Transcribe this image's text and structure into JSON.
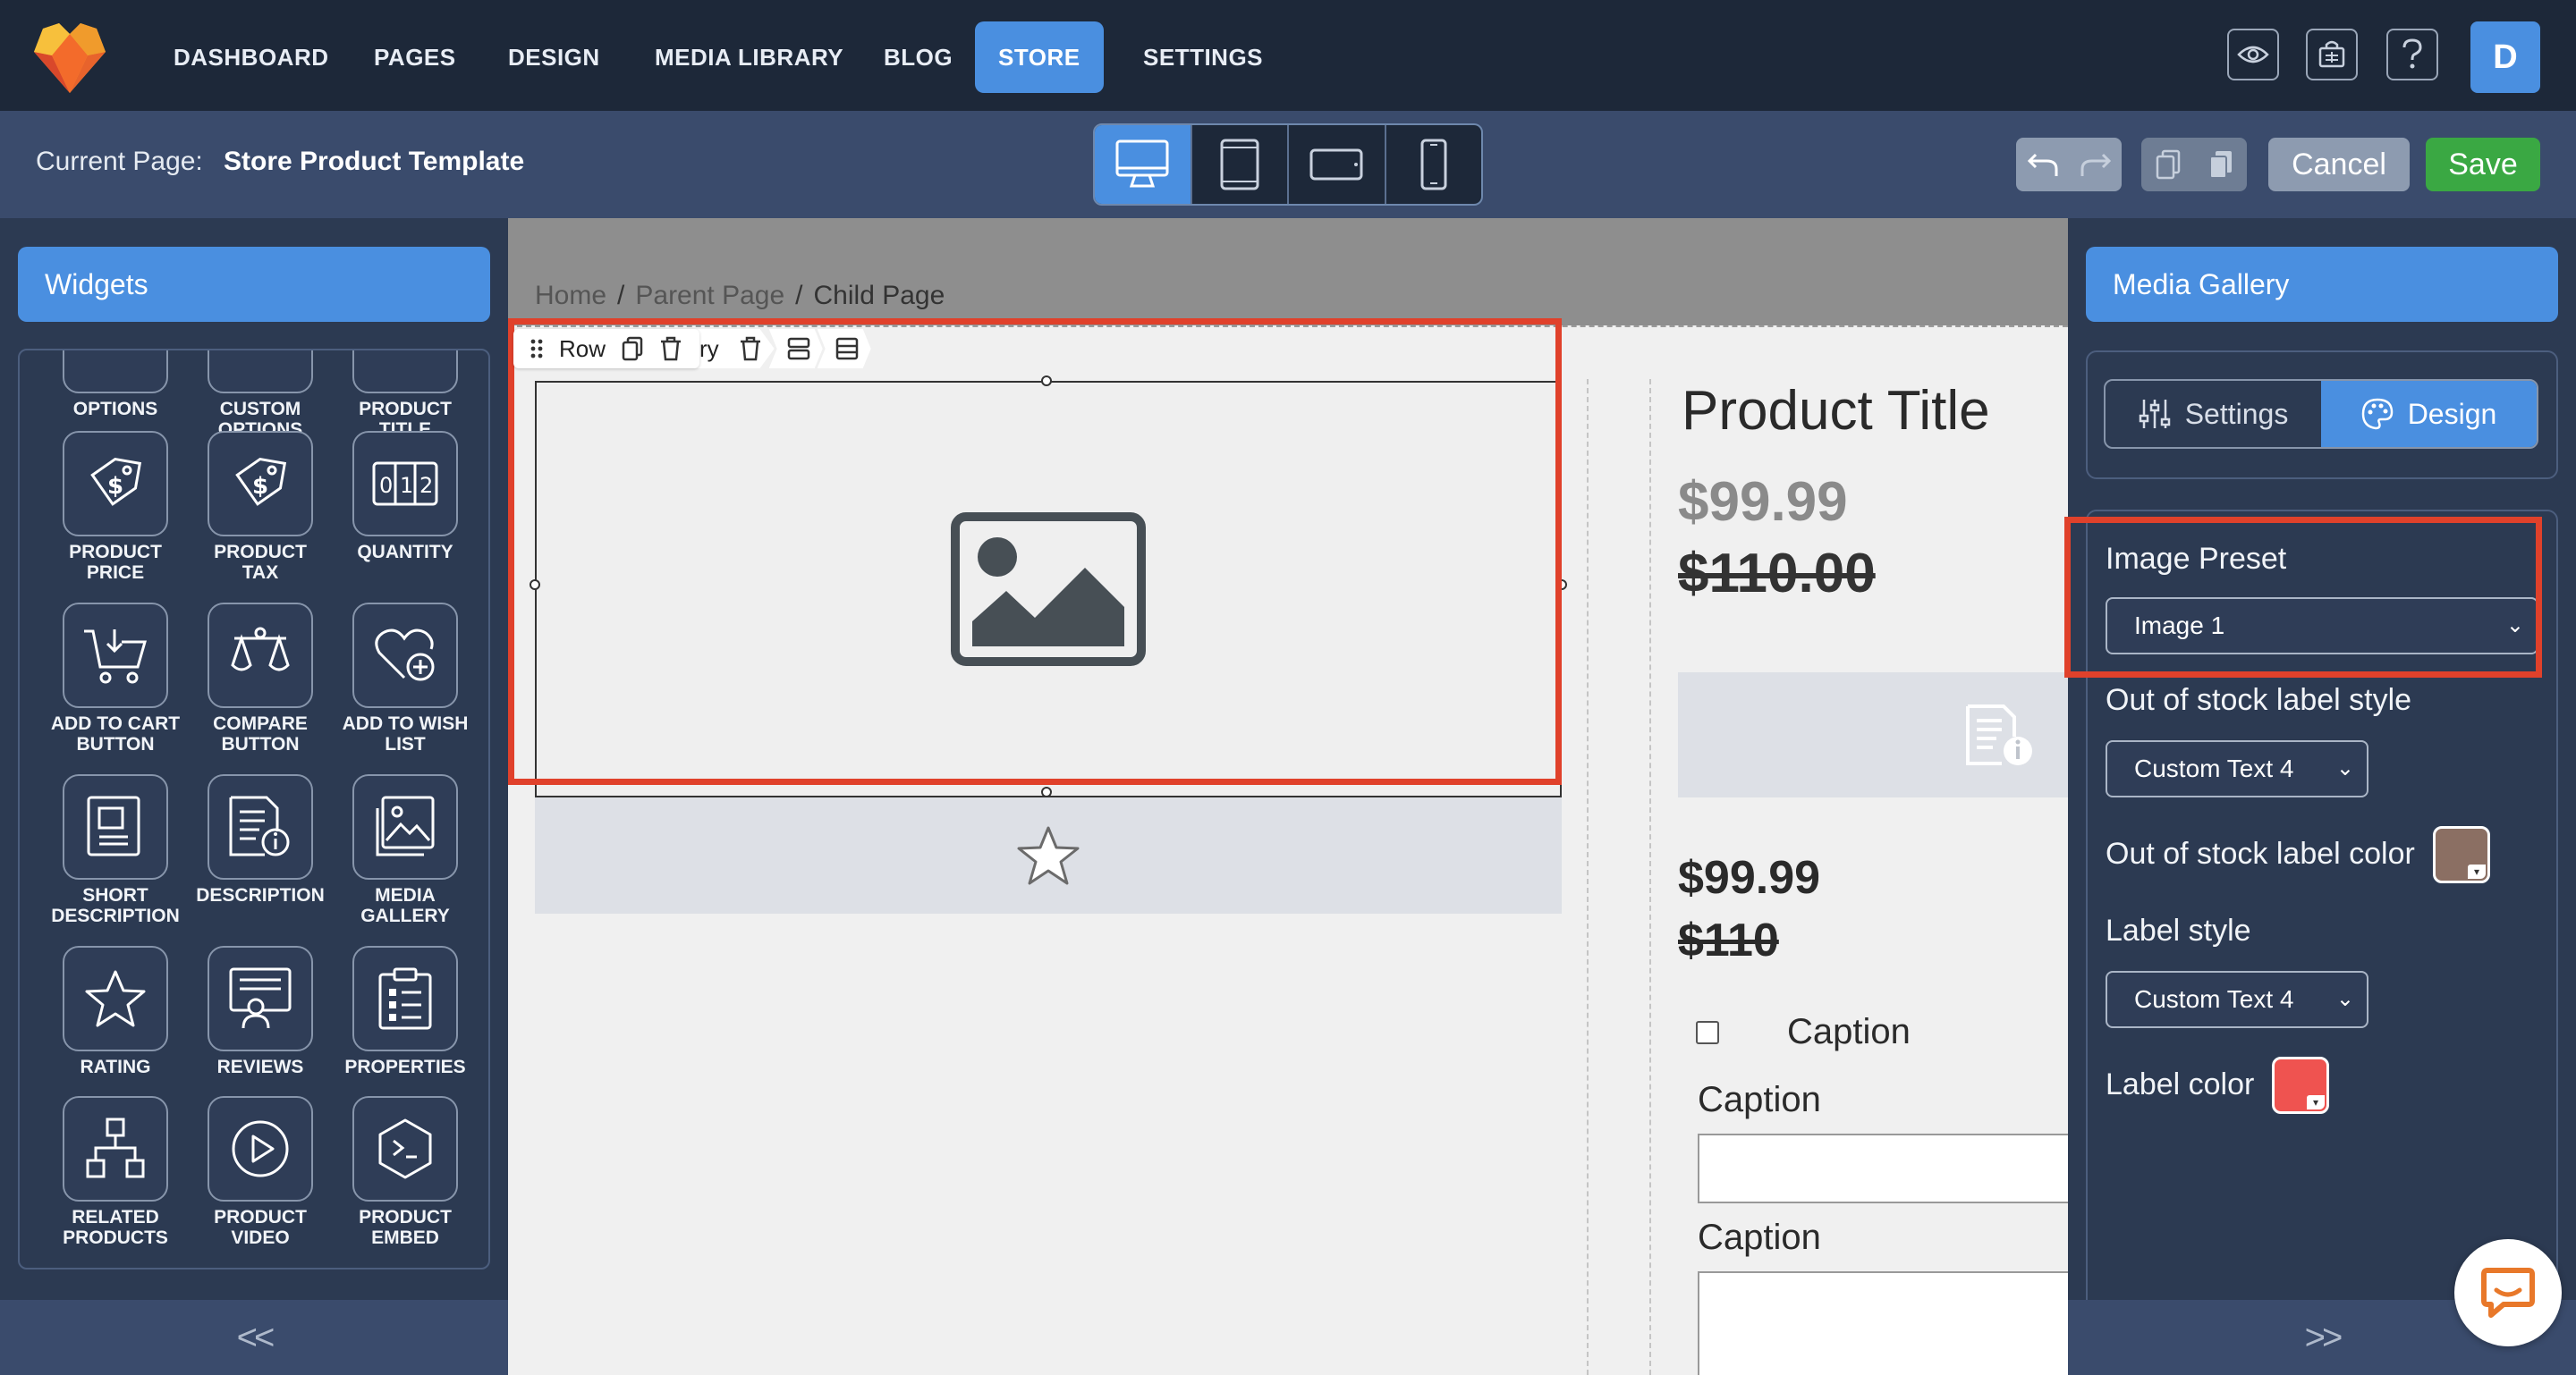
{
  "nav": {
    "items": [
      {
        "label": "DASHBOARD",
        "active": false
      },
      {
        "label": "PAGES",
        "active": false
      },
      {
        "label": "DESIGN",
        "active": false
      },
      {
        "label": "MEDIA LIBRARY",
        "active": false
      },
      {
        "label": "BLOG",
        "active": false
      },
      {
        "label": "STORE",
        "active": true
      },
      {
        "label": "SETTINGS",
        "active": false
      }
    ],
    "avatar_letter": "D",
    "icons": [
      "eye-icon",
      "store-icon",
      "help-icon"
    ]
  },
  "subbar": {
    "current_label": "Current Page:",
    "current_value": "Store Product Template",
    "devices": [
      "desktop-icon",
      "tablet-icon",
      "tablet-landscape-icon",
      "mobile-icon"
    ],
    "cancel_label": "Cancel",
    "save_label": "Save"
  },
  "widgets": {
    "title": "Widgets",
    "partial_top": [
      "OPTIONS",
      "CUSTOM\nOPTIONS",
      "PRODUCT\nTITLE"
    ],
    "items": [
      {
        "label": "PRODUCT\nPRICE",
        "icon": "price-tag-icon"
      },
      {
        "label": "PRODUCT TAX",
        "icon": "tax-tag-icon"
      },
      {
        "label": "QUANTITY",
        "icon": "quantity-icon"
      },
      {
        "label": "ADD TO CART\nBUTTON",
        "icon": "cart-icon"
      },
      {
        "label": "COMPARE\nBUTTON",
        "icon": "scales-icon"
      },
      {
        "label": "ADD TO WISH\nLIST",
        "icon": "heart-plus-icon"
      },
      {
        "label": "SHORT\nDESCRIPTION",
        "icon": "short-description-icon"
      },
      {
        "label": "DESCRIPTION",
        "icon": "description-icon"
      },
      {
        "label": "MEDIA\nGALLERY",
        "icon": "gallery-icon"
      },
      {
        "label": "RATING",
        "icon": "star-icon"
      },
      {
        "label": "REVIEWS",
        "icon": "reviews-icon"
      },
      {
        "label": "PROPERTIES",
        "icon": "properties-icon"
      },
      {
        "label": "RELATED\nPRODUCTS",
        "icon": "related-icon"
      },
      {
        "label": "PRODUCT\nVIDEO",
        "icon": "video-icon"
      },
      {
        "label": "PRODUCT\nEMBED",
        "icon": "embed-icon"
      }
    ],
    "collapse": "<<"
  },
  "canvas": {
    "breadcrumbs": [
      "Home",
      "Parent Page",
      "Child Page"
    ],
    "toolbar_row_label": "Row",
    "toolbar_sub_label": "ry",
    "product_title": "Product Title",
    "price": "$99.99",
    "old_price": "$110.00",
    "price2": "$99.99",
    "old_price2": "$110",
    "option_caption": "Caption",
    "caption1": "Caption",
    "caption2": "Caption"
  },
  "right": {
    "title": "Media Gallery",
    "tab_settings": "Settings",
    "tab_design": "Design",
    "image_preset_label": "Image Preset",
    "image_preset_value": "Image 1",
    "oos_style_label": "Out of stock label style",
    "oos_style_value": "Custom Text 4",
    "oos_color_label": "Out of stock label color",
    "oos_color": "#8b6f63",
    "label_style_label": "Label style",
    "label_style_value": "Custom Text 4",
    "label_color_label": "Label color",
    "label_color": "#ef5350",
    "expand": ">>"
  }
}
